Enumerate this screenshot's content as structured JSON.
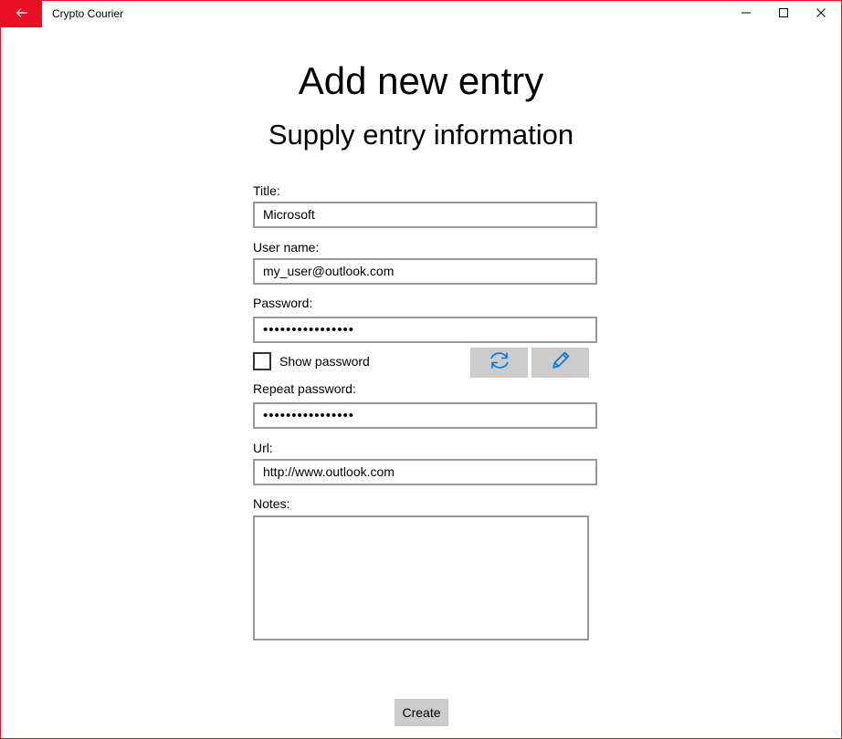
{
  "app": {
    "title": "Crypto Courier",
    "accent_color": "#e81123",
    "back_icon": "back-arrow-icon"
  },
  "caption": {
    "minimize_icon": "minimize-icon",
    "maximize_icon": "maximize-icon",
    "close_icon": "close-icon"
  },
  "page": {
    "title": "Add new entry",
    "subtitle": "Supply entry information"
  },
  "form": {
    "title_label": "Title:",
    "title_value": "Microsoft",
    "username_label": "User name:",
    "username_value": "my_user@outlook.com",
    "password_label": "Password:",
    "password_value": "••••••••••••••••",
    "show_password_label": "Show password",
    "show_password_checked": false,
    "regenerate_icon": "refresh-icon",
    "edit_icon": "pencil-icon",
    "repeat_password_label": "Repeat password:",
    "repeat_password_value": "••••••••••••••••",
    "url_label": "Url:",
    "url_value": "http://www.outlook.com",
    "notes_label": "Notes:",
    "notes_value": "",
    "icon_color": "#0078d7"
  },
  "actions": {
    "create_label": "Create"
  }
}
